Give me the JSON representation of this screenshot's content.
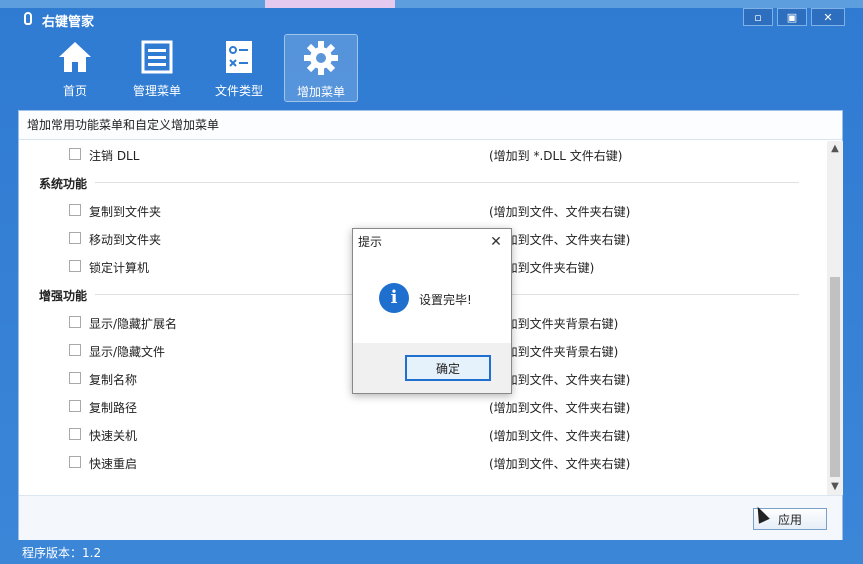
{
  "window": {
    "title": "右键管家",
    "controls": [
      "▫",
      "▣",
      "✕"
    ]
  },
  "toolbar": [
    {
      "label": "首页",
      "icon": "home-icon"
    },
    {
      "label": "管理菜单",
      "icon": "list-icon"
    },
    {
      "label": "文件类型",
      "icon": "checklist-icon"
    },
    {
      "label": "增加菜单",
      "icon": "gear-icon",
      "active": true
    }
  ],
  "content": {
    "subtitle": "增加常用功能菜单和自定义增加菜单",
    "top_item": {
      "name": "注销 DLL",
      "desc": "(增加到 *.DLL 文件右键)"
    },
    "groups": [
      {
        "title": "系统功能",
        "items": [
          {
            "name": "复制到文件夹",
            "desc": "(增加到文件、文件夹右键)"
          },
          {
            "name": "移动到文件夹",
            "desc": "(增加到文件、文件夹右键)"
          },
          {
            "name": "锁定计算机",
            "desc": "(增加到文件夹右键)"
          }
        ]
      },
      {
        "title": "增强功能",
        "items": [
          {
            "name": "显示/隐藏扩展名",
            "desc": "(增加到文件夹背景右键)"
          },
          {
            "name": "显示/隐藏文件",
            "desc": "(增加到文件夹背景右键)"
          },
          {
            "name": "复制名称",
            "desc": "(增加到文件、文件夹右键)"
          },
          {
            "name": "复制路径",
            "desc": "(增加到文件、文件夹右键)"
          },
          {
            "name": "快速关机",
            "desc": "(增加到文件、文件夹右键)"
          },
          {
            "name": "快速重启",
            "desc": "(增加到文件、文件夹右键)"
          }
        ]
      }
    ],
    "apply_label": "应用"
  },
  "status": {
    "version": "程序版本：1.2"
  },
  "dialog": {
    "title": "提示",
    "message": "设置完毕!",
    "ok_label": "确定",
    "icon": "info-icon"
  }
}
